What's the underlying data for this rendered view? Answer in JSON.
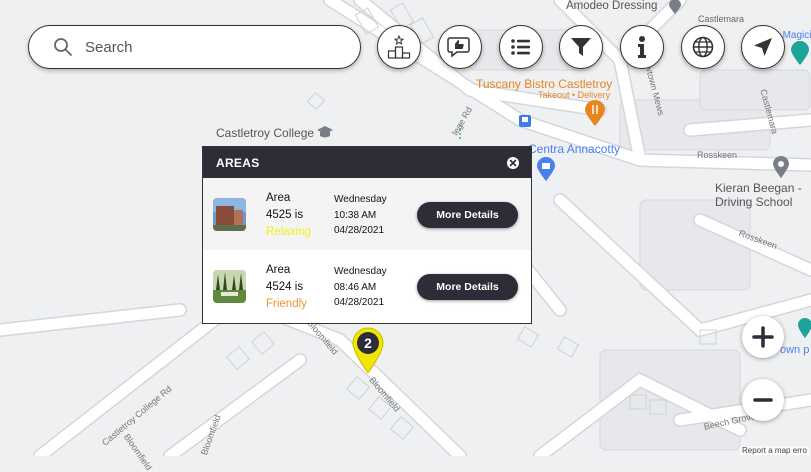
{
  "search": {
    "placeholder": "Search"
  },
  "toolbar": {
    "buttons": [
      {
        "icon": "podium-icon"
      },
      {
        "icon": "thumbs-up-chat-icon"
      },
      {
        "icon": "list-icon"
      },
      {
        "icon": "filter-icon"
      },
      {
        "icon": "info-icon"
      },
      {
        "icon": "globe-icon"
      },
      {
        "icon": "navigation-arrow-icon"
      }
    ]
  },
  "map": {
    "labels": {
      "amodeo": "Amodeo Dressing",
      "castlemara_top": "Castlemara",
      "bea_magicia": "l Bea Magicia",
      "tuscany": "Tuscany Bistro Castletroy",
      "tuscany_sub": "Takeout • Delivery",
      "castletroy_college": "Castletroy College",
      "college_rd": "lege Rd",
      "centra": "Centra Annacotty",
      "newtown_mews": "Newtown Mews",
      "castlemara_right": "Castlemara",
      "rosskeen_1": "Rosskeen",
      "rosskeen_2": "Rosskeen",
      "kieran_1": "Kieran Beegan -",
      "kieran_2": "Driving School",
      "bloomfield_1": "Bloomfield",
      "bloomfield_2": "Bloomfield",
      "bloomfield_3": "Bloomfield",
      "bloomfield_4": "Bloomfield",
      "castletroy_college_rd": "Castletroy College Rd",
      "own_p": "own p",
      "beech_grove": "Beech Grove",
      "report": "Report a map erro"
    },
    "marker_count": "2",
    "colors": {
      "marker": "#f2e600",
      "poi_orange": "#e8851e",
      "poi_blue": "#4a7ff0"
    }
  },
  "areas_panel": {
    "title": "AREAS",
    "items": [
      {
        "label": "Area",
        "number": "4525 is",
        "mood": "Relaxing",
        "mood_color": "#f2f21c",
        "day": "Wednesday",
        "time": "10:38 AM",
        "date": "04/28/2021",
        "button": "More Details"
      },
      {
        "label": "Area",
        "number": "4524 is",
        "mood": "Friendly",
        "mood_color": "#f29431",
        "day": "Wednesday",
        "time": "08:46 AM",
        "date": "04/28/2021",
        "button": "More Details"
      }
    ]
  },
  "zoom": {
    "in_icon": "plus-icon",
    "out_icon": "minus-icon"
  }
}
